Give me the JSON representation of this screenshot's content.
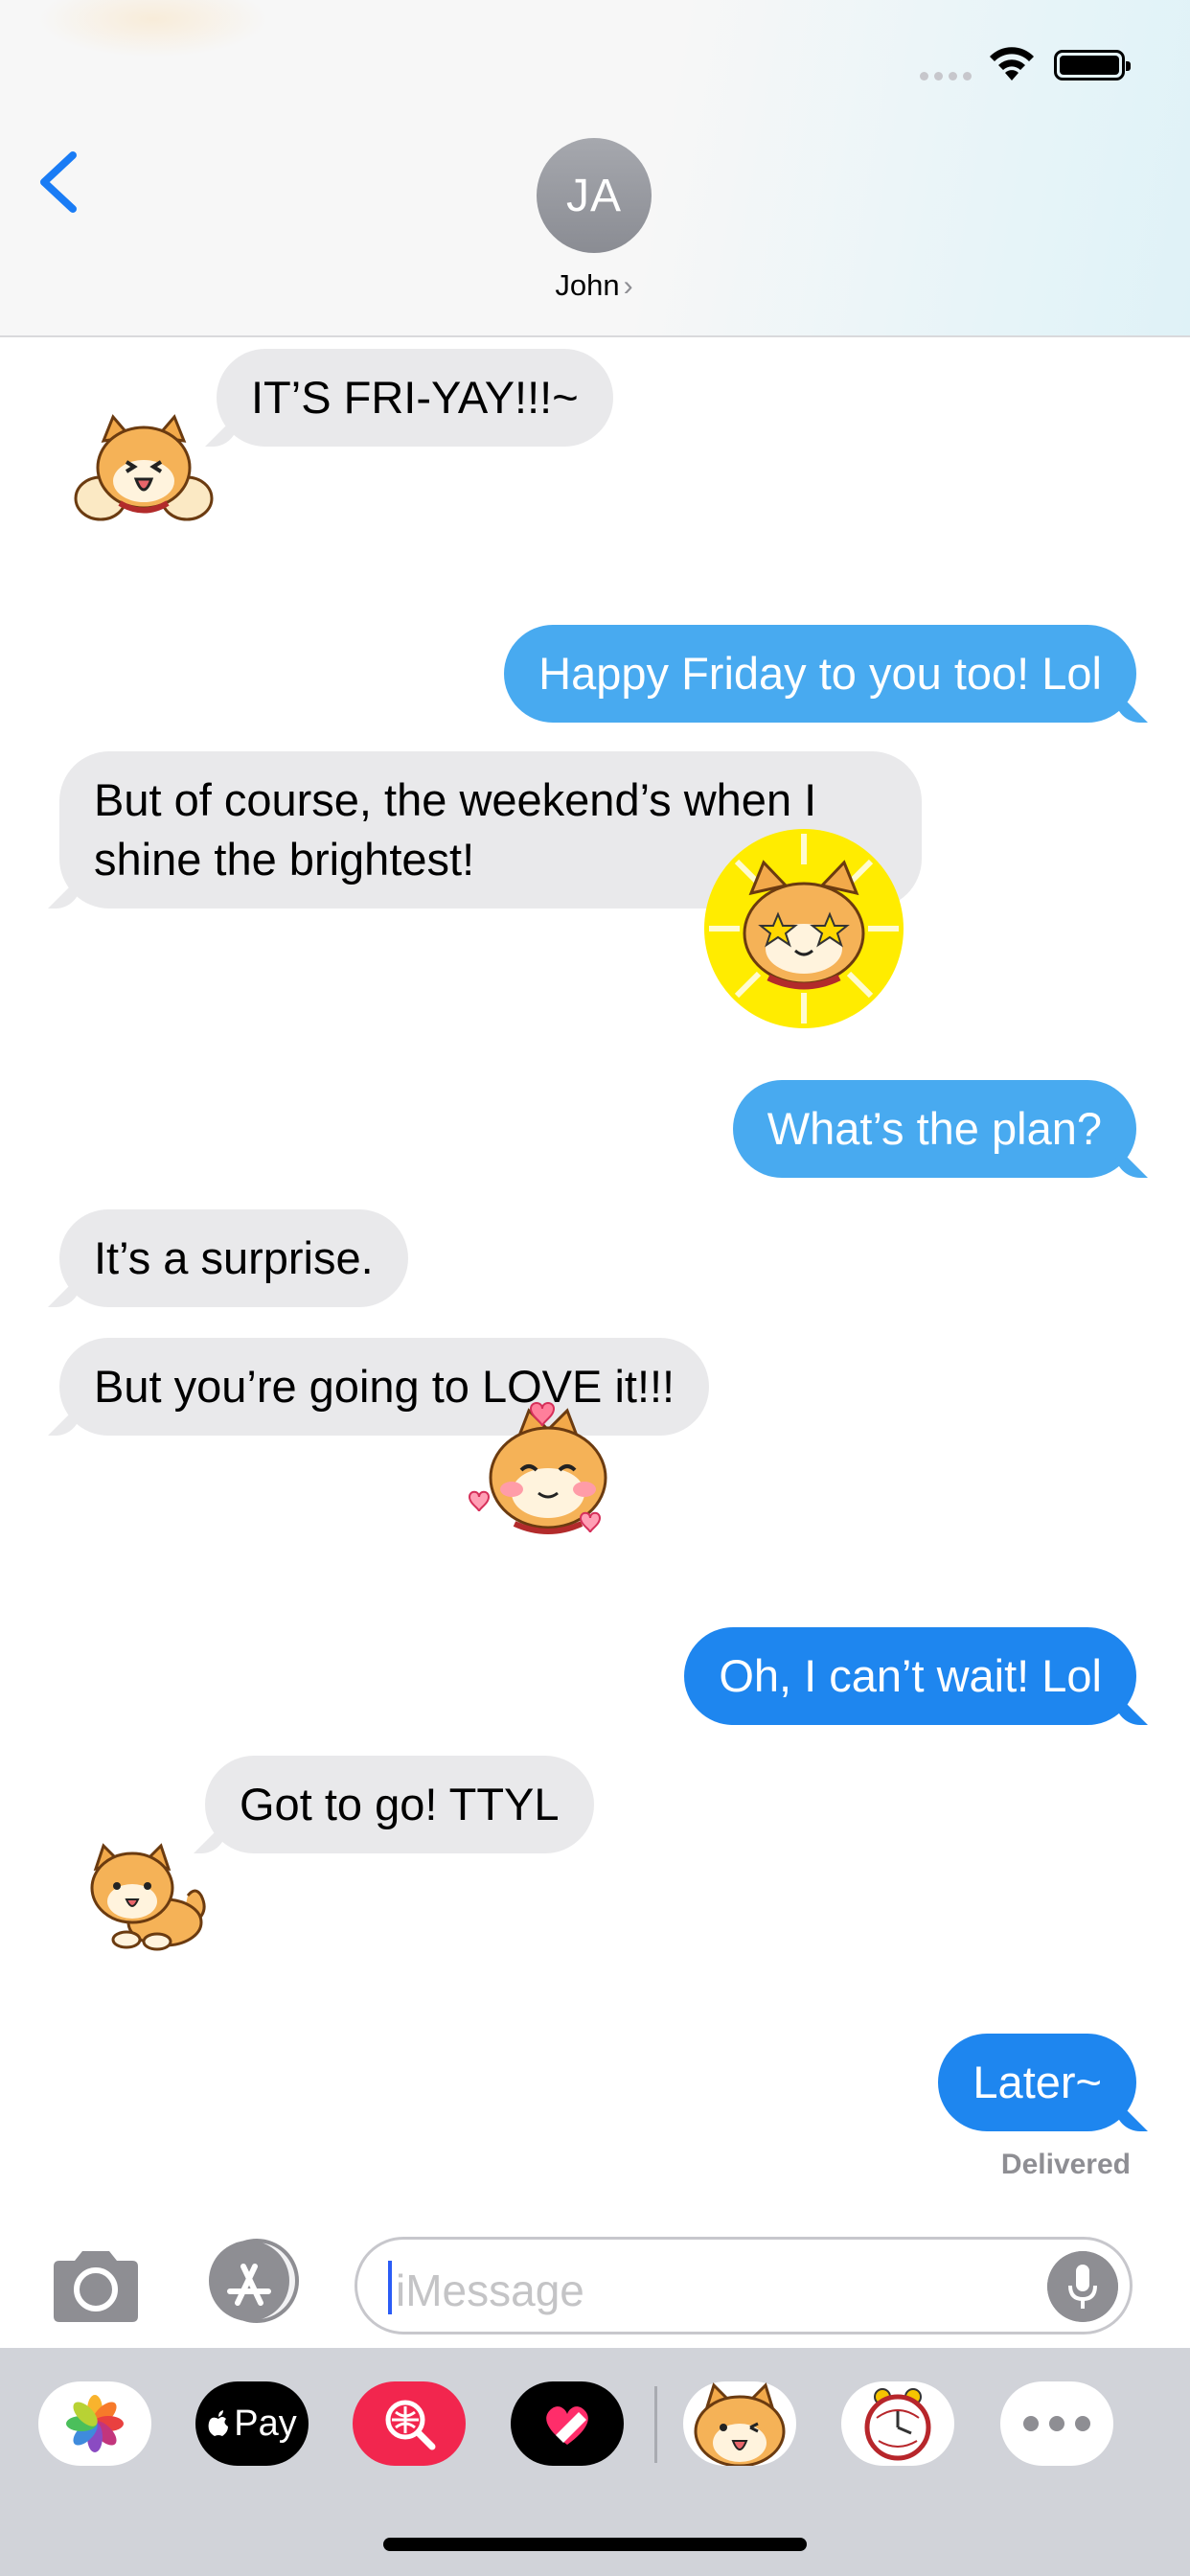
{
  "header": {
    "contact_initials": "JA",
    "contact_name": "John",
    "chevron": "›"
  },
  "messages": [
    {
      "side": "in",
      "text": "IT’S FRI-YAY!!!~",
      "sticker": "shiba-waving-sticker"
    },
    {
      "side": "out",
      "text": "Happy Friday to you too! Lol",
      "service": "sms"
    },
    {
      "side": "in",
      "text_lines": [
        "But of course, the weekend’s when I",
        "shine the brightest!"
      ],
      "sticker": "shiba-star-eyes-sticker"
    },
    {
      "side": "out",
      "text": "What’s the plan?",
      "service": "sms"
    },
    {
      "side": "in",
      "text": "It’s a surprise."
    },
    {
      "side": "in",
      "text": "But you’re going to LOVE it!!!",
      "sticker": "shiba-hearts-sticker"
    },
    {
      "side": "out",
      "text": "Oh, I can’t wait! Lol",
      "service": "imessage"
    },
    {
      "side": "in",
      "text": "Got to go! TTYL",
      "sticker": "shiba-sitting-sticker"
    },
    {
      "side": "out",
      "text": "Later~",
      "service": "imessage"
    }
  ],
  "status": {
    "delivered": "Delivered"
  },
  "input": {
    "placeholder": "iMessage"
  },
  "drawer": {
    "apps": [
      {
        "name": "photos-app-icon"
      },
      {
        "name": "apple-pay-app-icon",
        "label": "Pay"
      },
      {
        "name": "images-search-app-icon"
      },
      {
        "name": "digital-touch-app-icon"
      },
      {
        "name": "shiba-sticker-app-icon"
      },
      {
        "name": "better-late-sticker-app-icon"
      },
      {
        "name": "more-apps-icon"
      }
    ]
  },
  "colors": {
    "sms_bubble": "#48aaf0",
    "imessage_bubble": "#1e86ef",
    "incoming_bubble": "#e9e9eb",
    "accent": "#1a7cf5"
  }
}
